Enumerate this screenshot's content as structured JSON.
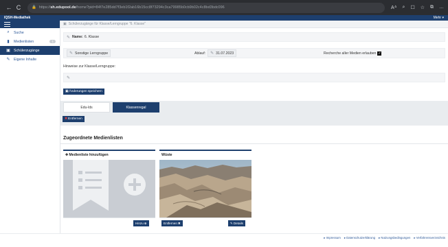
{
  "browser": {
    "url_prefix": "https://",
    "url_domain": "sh.edupool.de",
    "url_path": "/home?pid=84f7e285dd7f3eb1f2ab16b15cc8f73294c3ca79985b0cb9b02c4c8bd3bdc096",
    "back_glyph": "←",
    "reload_glyph": "C",
    "lock_glyph": "🔒",
    "icons": [
      "Aᐞ",
      "⌕",
      "☐",
      "☆",
      "⧉",
      "…"
    ]
  },
  "app": {
    "brand": "IQSH-Mediathek",
    "menu_label": "Mehr"
  },
  "sidebar": {
    "items": [
      {
        "label": "Suche",
        "icon": "search-icon"
      },
      {
        "label": "Medienlisten",
        "icon": "bookmark-icon",
        "badge": "1"
      },
      {
        "label": "Schülerzugänge",
        "icon": "students-icon",
        "active": true
      },
      {
        "label": "Eigene Inhalte",
        "icon": "edit-icon"
      }
    ]
  },
  "main": {
    "breadcrumb": "Schülerzugänge für Klasse/Lerngruppe \"6. Klasse\"",
    "name_label": "Name:",
    "name_value": "6. Klasse",
    "group_type": "Sonstige Lerngruppe",
    "expiry_label": "Ablauf:",
    "expiry_value": "31.07.2023",
    "research_label": "Recherche aller Medien erlauben",
    "hints_label": "Hinweise zur Klasse/Lerngruppe:",
    "save_label": "Änderungen speichern",
    "tabs": [
      {
        "label": "Edu-Ids",
        "active": false
      },
      {
        "label": "Klassenregal",
        "active": true
      }
    ],
    "remove_label": "Entfernen",
    "section_title": "Zugeordnete Medienlisten",
    "tiles": [
      {
        "title": "Medienliste hinzufügen",
        "button": "Hinzu"
      },
      {
        "title": "Wüste",
        "remove_button": "Entfernen",
        "details_button": "Details"
      }
    ]
  },
  "footer": {
    "links": [
      "Impressum",
      "Datenschutzerklärung",
      "Nutzungsbedingungen",
      "Verfahrens­verzeichnis"
    ]
  },
  "colors": {
    "primary": "#1d3f6e",
    "link": "#2b5797"
  }
}
